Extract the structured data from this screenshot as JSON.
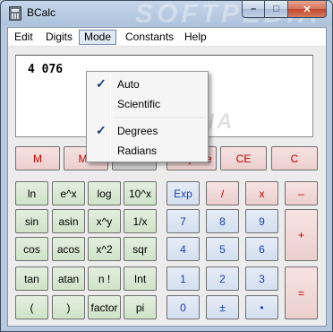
{
  "window": {
    "title": "BCalc",
    "watermark": "SOFTPEDIA",
    "controls": {
      "minimize": "–",
      "maximize": "□",
      "close": "✕"
    }
  },
  "menu": {
    "items": [
      "Edit",
      "Digits",
      "Mode",
      "Constants",
      "Help"
    ],
    "active": "Mode"
  },
  "mode_menu": {
    "items": [
      {
        "label": "Auto",
        "checked": true
      },
      {
        "label": "Scientific",
        "checked": false
      },
      {
        "label": "Degrees",
        "checked": true
      },
      {
        "label": "Radians",
        "checked": false
      }
    ],
    "check_glyph": "✓"
  },
  "display": {
    "value": "4 076",
    "watermark": "SOFTPEDIA"
  },
  "memory_row": [
    "M",
    "M+",
    "MR",
    "B Space",
    "CE",
    "C"
  ],
  "keypad": {
    "row1": [
      "ln",
      "e^x",
      "log",
      "10^x",
      "Exp",
      "/",
      "x",
      "–"
    ],
    "row2": [
      "sin",
      "asin",
      "x^y",
      "1/x",
      "7",
      "8",
      "9",
      "+"
    ],
    "row3": [
      "cos",
      "acos",
      "x^2",
      "sqr",
      "4",
      "5",
      "6"
    ],
    "row4": [
      "tan",
      "atan",
      "n !",
      "Int",
      "1",
      "2",
      "3",
      "="
    ],
    "row5": [
      "(",
      ")",
      "factor",
      "pi",
      "0",
      "±",
      "•"
    ]
  },
  "colors": {
    "memory_text": "#c00000",
    "digit_text": "#1b3fae",
    "function_bg": "#d6e8d0",
    "digit_bg": "#dbe5f3",
    "operator_bg": "#f1d8d8"
  }
}
